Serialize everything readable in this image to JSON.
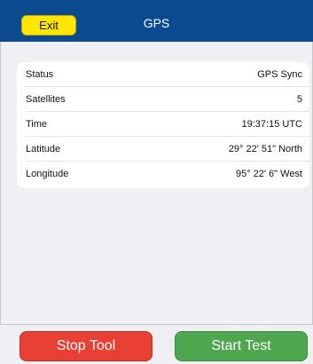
{
  "header": {
    "exit_label": "Exit",
    "title": "GPS"
  },
  "info": {
    "rows": [
      {
        "label": "Status",
        "value": "GPS Sync"
      },
      {
        "label": "Satellites",
        "value": "5"
      },
      {
        "label": "Time",
        "value": "19:37:15 UTC"
      },
      {
        "label": "Latitude",
        "value": "29° 22' 51\" North"
      },
      {
        "label": "Longitude",
        "value": "95° 22' 6\" West"
      }
    ]
  },
  "footer": {
    "stop_label": "Stop Tool",
    "start_label": "Start Test"
  },
  "colors": {
    "header_bg": "#0b4a8f",
    "exit_bg": "#ffe600",
    "stop_bg": "#e84033",
    "start_bg": "#4ea74e"
  }
}
